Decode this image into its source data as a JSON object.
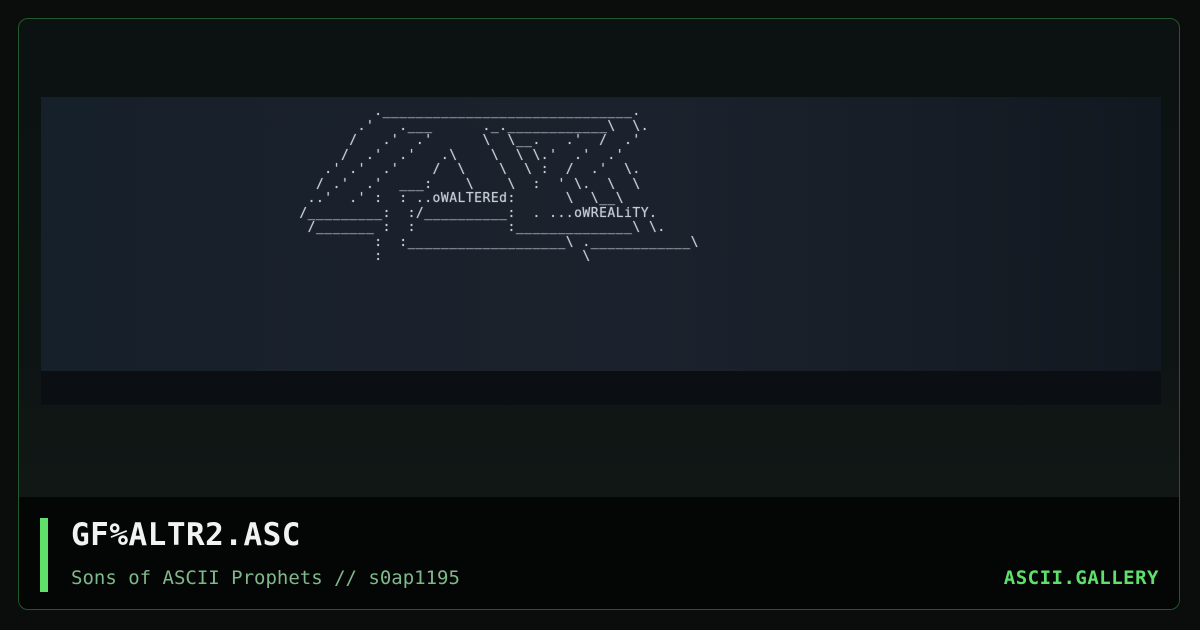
{
  "artwork": {
    "text_altered": "..oWALTEREd",
    "text_reality": "...oWREALiTY.",
    "lines": [
      "          .______________________________.",
      "        .'   .___      ._.____________\\  \\.",
      "       /   .'  .'      \\  \\__.   .'  /  .'",
      "      /  .'  .'   .\\    \\  \\ \\.'  .'  .'",
      "    .' .'  .'    /  \\    \\  \\ :  /  .'  \\.",
      "   / .'  .'  ___:    \\    \\  :  ' \\.  \\  \\",
      "  ..'  .' :  : ..oWALTEREd:      \\  \\__\\",
      " /_________:  :/__________:  . ...oWREALiTY.",
      "  /_______ :  :           :______________\\ \\.",
      "          :  :___________________\\ .____________\\",
      "          :                        \\"
    ]
  },
  "footer": {
    "title": "GF%ALTR2.ASC",
    "subtitle": "Sons of ASCII Prophets // s0ap1195",
    "brand": "ASCII.GALLERY"
  },
  "colors": {
    "accent": "#5ee06a",
    "frame_border": "#1f5a2c",
    "subtitle": "#7fb88a",
    "title": "#f2f2f2"
  }
}
